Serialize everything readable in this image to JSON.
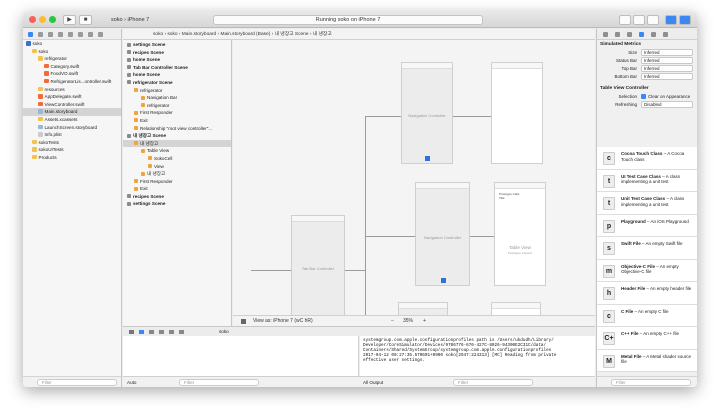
{
  "window": {
    "scheme_app": "soko",
    "scheme_device": "iPhone 7",
    "status": "Running soko on iPhone 7"
  },
  "navigator": {
    "items": [
      {
        "label": "soko",
        "indent": 0,
        "icon": "proj"
      },
      {
        "label": "soko",
        "indent": 1,
        "icon": "folder"
      },
      {
        "label": "refrigerator",
        "indent": 2,
        "icon": "folder"
      },
      {
        "label": "Category.swift",
        "indent": 3,
        "icon": "swift"
      },
      {
        "label": "FoodVO.swift",
        "indent": 3,
        "icon": "swift"
      },
      {
        "label": "RefrigeratorLis...ontroller.swift",
        "indent": 3,
        "icon": "swift"
      },
      {
        "label": "resources",
        "indent": 2,
        "icon": "folder"
      },
      {
        "label": "AppDelegate.swift",
        "indent": 2,
        "icon": "swift"
      },
      {
        "label": "ViewController.swift",
        "indent": 2,
        "icon": "swift"
      },
      {
        "label": "Main.storyboard",
        "indent": 2,
        "icon": "sb",
        "selected": true
      },
      {
        "label": "Assets.xcassets",
        "indent": 2,
        "icon": "folder"
      },
      {
        "label": "LaunchScreen.storyboard",
        "indent": 2,
        "icon": "sb"
      },
      {
        "label": "Info.plist",
        "indent": 2,
        "icon": "plain"
      },
      {
        "label": "sokoTests",
        "indent": 1,
        "icon": "folder"
      },
      {
        "label": "sokoUITests",
        "indent": 1,
        "icon": "folder"
      },
      {
        "label": "Products",
        "indent": 1,
        "icon": "folder"
      }
    ],
    "filter_placeholder": "Filter"
  },
  "jumpbar": {
    "path": "soko  ›  soko  ›  Main.storyboard  ›  Main.storyboard (Base)  ›  내 냉장고 Scene  ›  내 냉장고"
  },
  "outline": {
    "items": [
      {
        "label": "settings Scene",
        "indent": 0,
        "scene": true
      },
      {
        "label": "recipes Scene",
        "indent": 0,
        "scene": true
      },
      {
        "label": "home Scene",
        "indent": 0,
        "scene": true
      },
      {
        "label": "Tab Bar Controller Scene",
        "indent": 0,
        "scene": true
      },
      {
        "label": "home Scene",
        "indent": 0,
        "scene": true
      },
      {
        "label": "refrigerator Scene",
        "indent": 0,
        "scene": true
      },
      {
        "label": "refrigerator",
        "indent": 1
      },
      {
        "label": "Navigation Bar",
        "indent": 2
      },
      {
        "label": "refrigerator",
        "indent": 2
      },
      {
        "label": "First Responder",
        "indent": 1
      },
      {
        "label": "Exit",
        "indent": 1
      },
      {
        "label": "Relationship \"root view controller\"...",
        "indent": 1
      },
      {
        "label": "내 냉장고 Scene",
        "indent": 0,
        "scene": true
      },
      {
        "label": "내 냉장고",
        "indent": 1,
        "selected": true
      },
      {
        "label": "Table View",
        "indent": 2
      },
      {
        "label": "SokoCell",
        "indent": 3
      },
      {
        "label": "View",
        "indent": 3
      },
      {
        "label": "내 냉장고",
        "indent": 2
      },
      {
        "label": "First Responder",
        "indent": 1
      },
      {
        "label": "Exit",
        "indent": 1
      },
      {
        "label": "recipes Scene",
        "indent": 0,
        "scene": true
      },
      {
        "label": "settings Scene",
        "indent": 0,
        "scene": true
      }
    ]
  },
  "canvas": {
    "nav_controller_label": "Navigation Controller",
    "tab_bar_label": "Tab Bar Controller",
    "table_view_label": "Table View",
    "table_view_sub": "Prototype Content",
    "prototype_cells": "Prototype Cells",
    "title_label": "Title",
    "view_as": "View as: iPhone 7 (wC hR)",
    "zoom": "35%"
  },
  "debug": {
    "target": "soko",
    "auto": "Auto",
    "output": "All Output",
    "filter_placeholder": "Filter",
    "console_lines": [
      "systemgroup.com.apple.configurationprofiles path is /Users/ukdudh/Library/",
      "Developer/CoreSimulator/Devices/9706776-676-427C-8026-94300E2C31C/data/",
      "Containers/Shared/SystemGroup/systemgroup.com.apple.configurationprofiles",
      "2017-04-12 00:27:35.570601+0900 soko[2947:224313] [MC] Reading from private",
      "effective user settings."
    ]
  },
  "inspector": {
    "simulated_title": "Simulated Metrics",
    "metrics": [
      {
        "key": "Size",
        "value": "Inferred"
      },
      {
        "key": "Status Bar",
        "value": "Inferred"
      },
      {
        "key": "Top Bar",
        "value": "Inferred"
      },
      {
        "key": "Bottom Bar",
        "value": "Inferred"
      }
    ],
    "tvc_title": "Table View Controller",
    "selection_key": "Selection",
    "selection_value": "Clear on Appearance",
    "refreshing_key": "Refreshing",
    "refreshing_value": "Disabled",
    "library": [
      {
        "title": "Cocoa Touch Class",
        "desc": "A Cocoa Touch class",
        "icon": "c"
      },
      {
        "title": "UI Test Case Class",
        "desc": "A class implementing a unit test",
        "icon": "t"
      },
      {
        "title": "Unit Test Case Class",
        "desc": "A class implementing a unit test",
        "icon": "t"
      },
      {
        "title": "Playground",
        "desc": "An iOS Playground",
        "icon": "p"
      },
      {
        "title": "Swift File",
        "desc": "An empty Swift file",
        "icon": "s"
      },
      {
        "title": "Objective-C File",
        "desc": "An empty Objective-C file",
        "icon": "m"
      },
      {
        "title": "Header File",
        "desc": "An empty header file",
        "icon": "h"
      },
      {
        "title": "C File",
        "desc": "An empty C file",
        "icon": "c"
      },
      {
        "title": "C++ File",
        "desc": "An empty C++ file",
        "icon": "C+"
      },
      {
        "title": "Metal File",
        "desc": "A Metal shader source file",
        "icon": "M"
      }
    ],
    "filter_placeholder": "Filter"
  }
}
